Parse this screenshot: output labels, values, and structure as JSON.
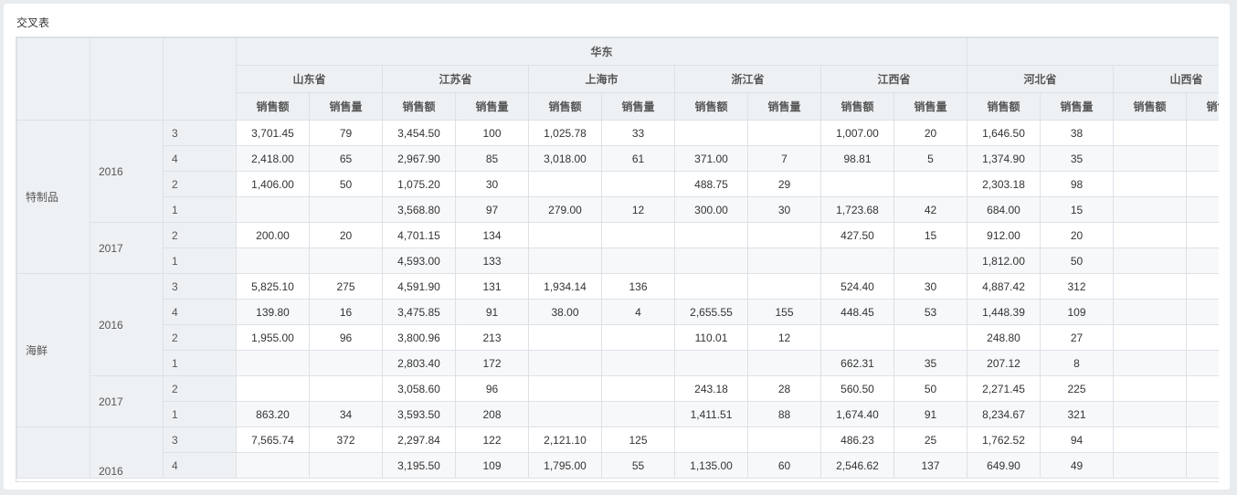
{
  "panel": {
    "title": "交叉表"
  },
  "header": {
    "region": "华东",
    "provinces": [
      "山东省",
      "江苏省",
      "上海市",
      "浙江省",
      "江西省",
      "河北省",
      "山西省"
    ],
    "measures": [
      "销售额",
      "销售量"
    ]
  },
  "groups": [
    {
      "category": "特制品",
      "years": [
        {
          "year": "2016",
          "rows": [
            {
              "q": "3",
              "cells": [
                "3,701.45",
                "79",
                "3,454.50",
                "100",
                "1,025.78",
                "33",
                "",
                "",
                "1,007.00",
                "20",
                "1,646.50",
                "38",
                "",
                ""
              ]
            },
            {
              "q": "4",
              "cells": [
                "2,418.00",
                "65",
                "2,967.90",
                "85",
                "3,018.00",
                "61",
                "371.00",
                "7",
                "98.81",
                "5",
                "1,374.90",
                "35",
                "",
                ""
              ]
            },
            {
              "q": "2",
              "cells": [
                "1,406.00",
                "50",
                "1,075.20",
                "30",
                "",
                "",
                "488.75",
                "29",
                "",
                "",
                "2,303.18",
                "98",
                "",
                ""
              ]
            },
            {
              "q": "1",
              "cells": [
                "",
                "",
                "3,568.80",
                "97",
                "279.00",
                "12",
                "300.00",
                "30",
                "1,723.68",
                "42",
                "684.00",
                "15",
                "",
                ""
              ]
            }
          ]
        },
        {
          "year": "2017",
          "rows": [
            {
              "q": "2",
              "cells": [
                "200.00",
                "20",
                "4,701.15",
                "134",
                "",
                "",
                "",
                "",
                "427.50",
                "15",
                "912.00",
                "20",
                "",
                ""
              ]
            },
            {
              "q": "1",
              "cells": [
                "",
                "",
                "4,593.00",
                "133",
                "",
                "",
                "",
                "",
                "",
                "",
                "1,812.00",
                "50",
                "",
                ""
              ]
            }
          ]
        }
      ]
    },
    {
      "category": "海鲜",
      "years": [
        {
          "year": "2016",
          "rows": [
            {
              "q": "3",
              "cells": [
                "5,825.10",
                "275",
                "4,591.90",
                "131",
                "1,934.14",
                "136",
                "",
                "",
                "524.40",
                "30",
                "4,887.42",
                "312",
                "",
                ""
              ]
            },
            {
              "q": "4",
              "cells": [
                "139.80",
                "16",
                "3,475.85",
                "91",
                "38.00",
                "4",
                "2,655.55",
                "155",
                "448.45",
                "53",
                "1,448.39",
                "109",
                "",
                ""
              ]
            },
            {
              "q": "2",
              "cells": [
                "1,955.00",
                "96",
                "3,800.96",
                "213",
                "",
                "",
                "110.01",
                "12",
                "",
                "",
                "248.80",
                "27",
                "",
                ""
              ]
            },
            {
              "q": "1",
              "cells": [
                "",
                "",
                "2,803.40",
                "172",
                "",
                "",
                "",
                "",
                "662.31",
                "35",
                "207.12",
                "8",
                "",
                ""
              ]
            }
          ]
        },
        {
          "year": "2017",
          "rows": [
            {
              "q": "2",
              "cells": [
                "",
                "",
                "3,058.60",
                "96",
                "",
                "",
                "243.18",
                "28",
                "560.50",
                "50",
                "2,271.45",
                "225",
                "",
                ""
              ]
            },
            {
              "q": "1",
              "cells": [
                "863.20",
                "34",
                "3,593.50",
                "208",
                "",
                "",
                "1,411.51",
                "88",
                "1,674.40",
                "91",
                "8,234.67",
                "321",
                "",
                ""
              ]
            }
          ]
        }
      ]
    },
    {
      "category": "",
      "years": [
        {
          "year": "2016",
          "rows": [
            {
              "q": "3",
              "cells": [
                "7,565.74",
                "372",
                "2,297.84",
                "122",
                "2,121.10",
                "125",
                "",
                "",
                "486.23",
                "25",
                "1,762.52",
                "94",
                "",
                ""
              ]
            },
            {
              "q": "4",
              "cells": [
                "",
                "",
                "3,195.50",
                "109",
                "1,795.00",
                "55",
                "1,135.00",
                "60",
                "2,546.62",
                "137",
                "649.90",
                "49",
                "",
                ""
              ]
            }
          ]
        }
      ]
    }
  ]
}
